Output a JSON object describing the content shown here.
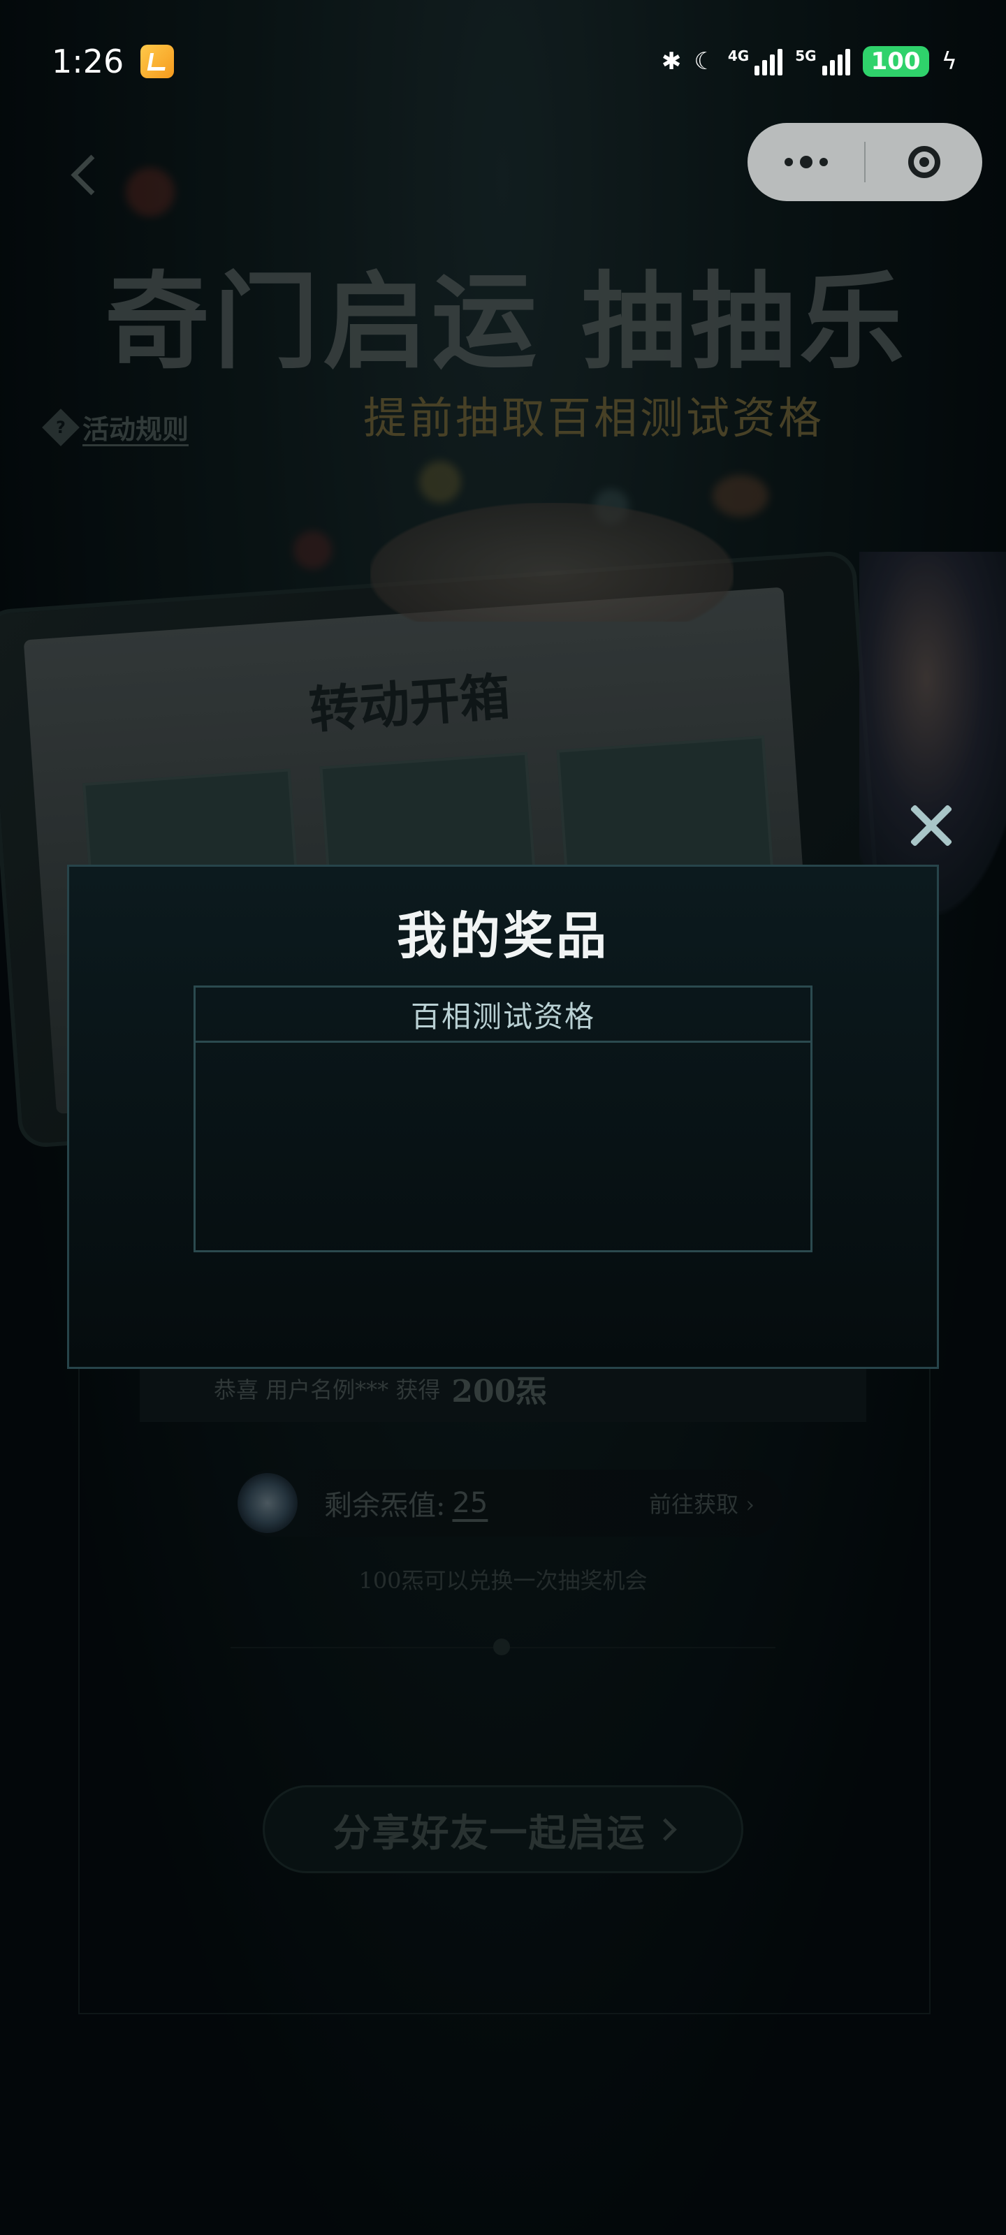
{
  "status_bar": {
    "time": "1:26",
    "network_4g": "4G",
    "network_5g": "5G",
    "battery": "100"
  },
  "page": {
    "title": "奇门启运 抽抽乐",
    "subtitle": "提前抽取百相测试资格",
    "rules_label": "活动规则",
    "screen_title": "转动开箱",
    "congrats_text": "恭喜 用户名例*** 获得",
    "congrats_amount": "200炁",
    "remaining_label": "剩余炁值:",
    "remaining_value": "25",
    "goto_label": "前往获取 ›",
    "exchange_note": "100炁可以兑换一次抽奖机会",
    "share_label": "分享好友一起启运"
  },
  "modal": {
    "title": "我的奖品",
    "table_header": "百相测试资格",
    "rows": []
  },
  "colors": {
    "modal_border": "#27444a",
    "modal_title": "#f1f4f4",
    "battery_green": "#2fd26b",
    "capsule_bg": "#b9bcbc"
  },
  "icons": {
    "back": "back-chevron-icon",
    "rules": "question-diamond-icon",
    "close": "close-icon",
    "capsule_more": "more-dots-icon",
    "capsule_exit": "target-circle-icon"
  }
}
